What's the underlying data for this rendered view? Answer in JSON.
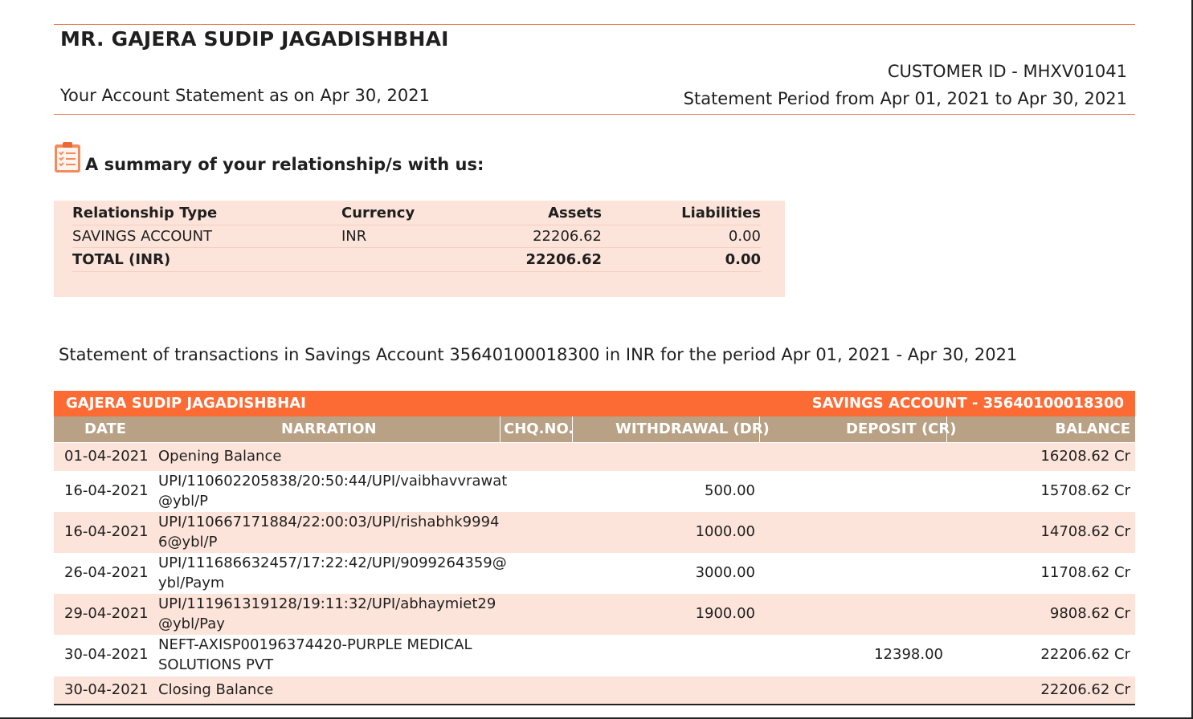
{
  "header": {
    "customer_name": "MR. GAJERA SUDIP JAGADISHBHAI",
    "statement_as_on": "Your Account Statement as on Apr 30, 2021",
    "customer_id": "CUSTOMER ID - MHXV01041",
    "statement_period": "Statement Period from Apr 01, 2021 to Apr 30, 2021"
  },
  "summary": {
    "icon": "clipboard-checklist-icon",
    "title": "A summary of your relationship/s with us:",
    "columns": [
      "Relationship Type",
      "Currency",
      "Assets",
      "Liabilities"
    ],
    "rows": [
      [
        "SAVINGS ACCOUNT",
        "INR",
        "22206.62",
        "0.00"
      ]
    ],
    "total": [
      "TOTAL (INR)",
      "",
      "22206.62",
      "0.00"
    ]
  },
  "statement_line": "Statement of transactions in Savings Account 35640100018300 in INR for the period  Apr 01, 2021 - Apr 30, 2021",
  "transactions": {
    "holder": "GAJERA SUDIP JAGADISHBHAI",
    "account": "SAVINGS ACCOUNT - 35640100018300",
    "columns": [
      "DATE",
      "NARRATION",
      "CHQ.NO.",
      "WITHDRAWAL (DR)",
      "DEPOSIT (CR)",
      "BALANCE"
    ],
    "rows": [
      {
        "date": "01-04-2021",
        "narration": [
          "Opening Balance"
        ],
        "chq": "",
        "withdrawal": "",
        "deposit": "",
        "balance": "16208.62 Cr"
      },
      {
        "date": "16-04-2021",
        "narration": [
          "UPI/110602205838/20:50:44/UPI/vaibhavvrawat",
          "@ybl/P"
        ],
        "chq": "",
        "withdrawal": "500.00",
        "deposit": "",
        "balance": "15708.62 Cr"
      },
      {
        "date": "16-04-2021",
        "narration": [
          "UPI/110667171884/22:00:03/UPI/rishabhk9994",
          "6@ybl/P"
        ],
        "chq": "",
        "withdrawal": "1000.00",
        "deposit": "",
        "balance": "14708.62 Cr"
      },
      {
        "date": "26-04-2021",
        "narration": [
          "UPI/111686632457/17:22:42/UPI/9099264359@",
          "ybl/Paym"
        ],
        "chq": "",
        "withdrawal": "3000.00",
        "deposit": "",
        "balance": "11708.62 Cr"
      },
      {
        "date": "29-04-2021",
        "narration": [
          "UPI/111961319128/19:11:32/UPI/abhaymiet29",
          "@ybl/Pay"
        ],
        "chq": "",
        "withdrawal": "1900.00",
        "deposit": "",
        "balance": "9808.62 Cr"
      },
      {
        "date": "30-04-2021",
        "narration": [
          "NEFT-AXISP00196374420-PURPLE MEDICAL",
          "SOLUTIONS PVT"
        ],
        "chq": "",
        "withdrawal": "",
        "deposit": "12398.00",
        "balance": "22206.62 Cr"
      },
      {
        "date": "30-04-2021",
        "narration": [
          "Closing Balance"
        ],
        "chq": "",
        "withdrawal": "",
        "deposit": "",
        "balance": "22206.62 Cr"
      }
    ]
  },
  "colors": {
    "accent_orange": "#fd6b35",
    "rule_orange": "#e8804f",
    "column_header_tan": "#b8a184",
    "row_tint": "#fce4da"
  }
}
